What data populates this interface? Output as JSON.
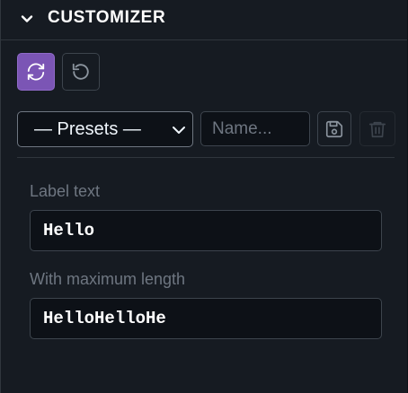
{
  "header": {
    "title": "CUSTOMIZER",
    "collapse_icon": "chevron-down-icon"
  },
  "toolbar": {
    "sync_icon": "sync-icon",
    "reset_icon": "reset-icon",
    "active_color": "#7b55b5"
  },
  "presets": {
    "selected": "— Presets —",
    "name_placeholder": "Name...",
    "save_icon": "save-icon",
    "delete_icon": "trash-icon"
  },
  "fields": [
    {
      "label": "Label text",
      "value": "Hello"
    },
    {
      "label": "With maximum length",
      "value": "HelloHelloHe"
    }
  ]
}
